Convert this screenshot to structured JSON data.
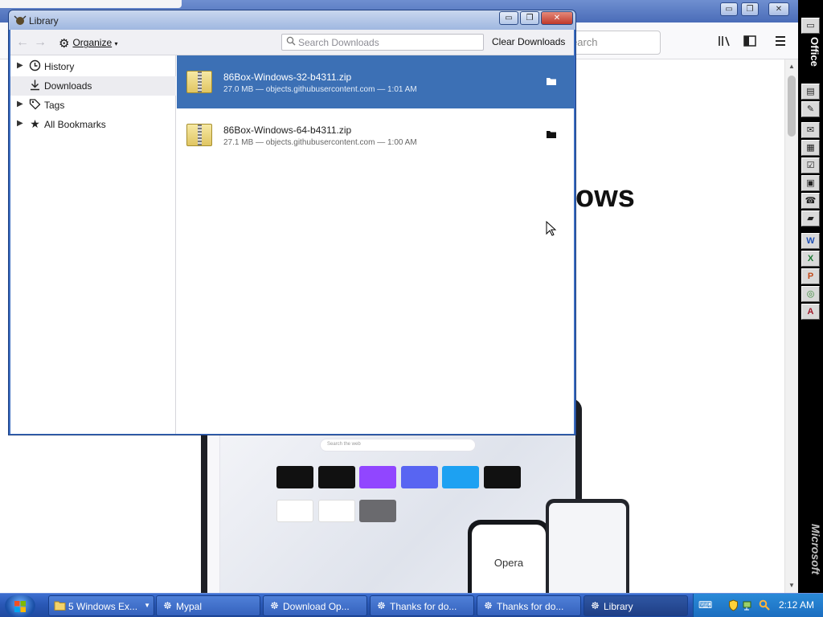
{
  "background_browser": {
    "search_placeholder": "earch",
    "heading_fragment": "ows",
    "window_buttons": [
      "▭",
      "❐",
      "✕"
    ],
    "toolbar_icons": [
      "library-icon",
      "sidebar-icon",
      "menu-icon"
    ],
    "opera": {
      "search_placeholder": "Search the web",
      "phone_text": "Opera",
      "tile_colors": [
        "#111111",
        "#111111",
        "#9146ff",
        "#5865f2",
        "#1da1f2",
        "#111111",
        "#ffffff",
        "#ffffff",
        "#6a6a6e"
      ]
    }
  },
  "office_bar": {
    "label": "Office",
    "brand": "Microsoft",
    "buttons": [
      "folder-icon",
      "binder-icon",
      "clipart-icon",
      "mail-icon",
      "calendar-icon",
      "tasks-icon",
      "contacts-icon",
      "journal-icon",
      "notes-icon",
      "word-icon",
      "excel-icon",
      "powerpoint-icon",
      "publisher-icon",
      "access-icon"
    ]
  },
  "library": {
    "title": "Library",
    "window_buttons": {
      "minimize": "▭",
      "maximize": "❐",
      "close": "✕"
    },
    "toolbar": {
      "organize_label": "Organize",
      "search_placeholder": "Search Downloads",
      "clear_label": "Clear Downloads"
    },
    "sidebar": [
      {
        "label": "History",
        "icon": "clock-icon",
        "expandable": true
      },
      {
        "label": "Downloads",
        "icon": "download-icon",
        "expandable": false,
        "selected": true
      },
      {
        "label": "Tags",
        "icon": "tag-icon",
        "expandable": true
      },
      {
        "label": "All Bookmarks",
        "icon": "star-icon",
        "expandable": true
      }
    ],
    "downloads": [
      {
        "name": "86Box-Windows-32-b4311.zip",
        "meta": "27.0 MB — objects.githubusercontent.com — 1:01 AM",
        "selected": true
      },
      {
        "name": "86Box-Windows-64-b4311.zip",
        "meta": "27.1 MB — objects.githubusercontent.com — 1:00 AM",
        "selected": false
      }
    ]
  },
  "taskbar": {
    "buttons": [
      {
        "label": "5 Windows Ex...",
        "icon": "folder-icon",
        "has_menu": true
      },
      {
        "label": "Mypal",
        "icon": "mypal-icon"
      },
      {
        "label": "Download Op...",
        "icon": "mypal-icon"
      },
      {
        "label": "Thanks for do...",
        "icon": "mypal-icon"
      },
      {
        "label": "Thanks for do...",
        "icon": "mypal-icon"
      },
      {
        "label": "Library",
        "icon": "mypal-icon",
        "active": true
      }
    ],
    "clock": "2:12 AM"
  }
}
